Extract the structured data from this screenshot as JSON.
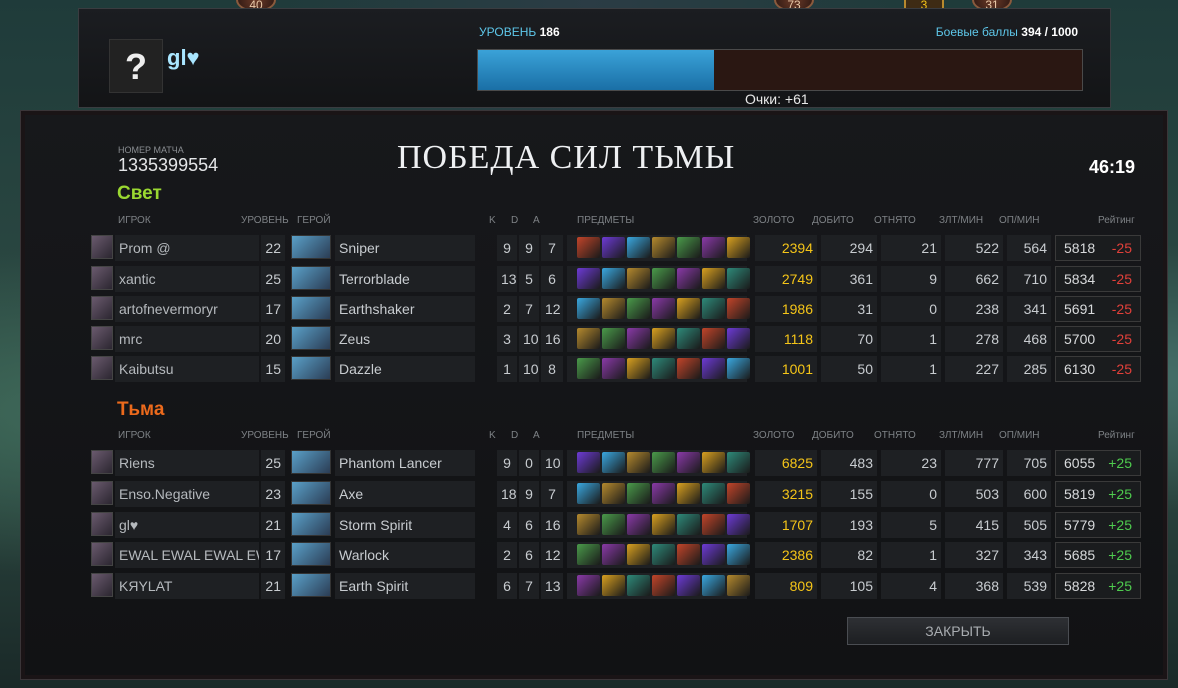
{
  "top_badges": [
    "40",
    "73",
    "3",
    "31"
  ],
  "profile": {
    "avatar": "?",
    "name": "gl♥"
  },
  "level": {
    "label": "УРОВЕНЬ",
    "value": "186",
    "progress": 0.39
  },
  "battle_points": {
    "label": "Боевые баллы",
    "value": "394 / 1000"
  },
  "score_gain": "Очки: +61",
  "match": {
    "label": "НОМЕР МАТЧА",
    "id": "1335399554",
    "result": "ПОБЕДА СИЛ ТЬМЫ",
    "duration": "46:19"
  },
  "headers": {
    "player": "ИГРОК",
    "level": "УРОВЕНЬ",
    "hero": "ГЕРОЙ",
    "k": "K",
    "d": "D",
    "a": "A",
    "items": "ПРЕДМЕТЫ",
    "gold": "ЗОЛОТО",
    "lh": "ДОБИТО",
    "dn": "ОТНЯТО",
    "gpm": "ЗЛТ/МИН",
    "xpm": "ОП/МИН",
    "rating": "Рейтинг"
  },
  "teams": [
    {
      "name": "Свет",
      "players": [
        {
          "player": "Prom @",
          "level": "22",
          "hero": "Sniper",
          "k": "9",
          "d": "9",
          "a": "7",
          "gold": "2394",
          "lh": "294",
          "dn": "21",
          "gpm": "522",
          "xpm": "564",
          "rating": "5818",
          "delta": "-25"
        },
        {
          "player": "xantic",
          "level": "25",
          "hero": "Terrorblade",
          "k": "13",
          "d": "5",
          "a": "6",
          "gold": "2749",
          "lh": "361",
          "dn": "9",
          "gpm": "662",
          "xpm": "710",
          "rating": "5834",
          "delta": "-25"
        },
        {
          "player": "artofnevermoryr",
          "level": "17",
          "hero": "Earthshaker",
          "k": "2",
          "d": "7",
          "a": "12",
          "gold": "1986",
          "lh": "31",
          "dn": "0",
          "gpm": "238",
          "xpm": "341",
          "rating": "5691",
          "delta": "-25"
        },
        {
          "player": "mrc",
          "level": "20",
          "hero": "Zeus",
          "k": "3",
          "d": "10",
          "a": "16",
          "gold": "1118",
          "lh": "70",
          "dn": "1",
          "gpm": "278",
          "xpm": "468",
          "rating": "5700",
          "delta": "-25"
        },
        {
          "player": "Kaibutsu",
          "level": "15",
          "hero": "Dazzle",
          "k": "1",
          "d": "10",
          "a": "8",
          "gold": "1001",
          "lh": "50",
          "dn": "1",
          "gpm": "227",
          "xpm": "285",
          "rating": "6130",
          "delta": "-25"
        }
      ]
    },
    {
      "name": "Тьма",
      "players": [
        {
          "player": "Riens",
          "level": "25",
          "hero": "Phantom Lancer",
          "k": "9",
          "d": "0",
          "a": "10",
          "gold": "6825",
          "lh": "483",
          "dn": "23",
          "gpm": "777",
          "xpm": "705",
          "rating": "6055",
          "delta": "+25"
        },
        {
          "player": "Enso.Negative",
          "level": "23",
          "hero": "Axe",
          "k": "18",
          "d": "9",
          "a": "7",
          "gold": "3215",
          "lh": "155",
          "dn": "0",
          "gpm": "503",
          "xpm": "600",
          "rating": "5819",
          "delta": "+25"
        },
        {
          "player": "gl♥",
          "level": "21",
          "hero": "Storm Spirit",
          "k": "4",
          "d": "6",
          "a": "16",
          "gold": "1707",
          "lh": "193",
          "dn": "5",
          "gpm": "415",
          "xpm": "505",
          "rating": "5779",
          "delta": "+25"
        },
        {
          "player": "EWAL EWAL EWAL EWAL",
          "level": "17",
          "hero": "Warlock",
          "k": "2",
          "d": "6",
          "a": "12",
          "gold": "2386",
          "lh": "82",
          "dn": "1",
          "gpm": "327",
          "xpm": "343",
          "rating": "5685",
          "delta": "+25"
        },
        {
          "player": "KЯYLAT",
          "level": "21",
          "hero": "Earth Spirit",
          "k": "6",
          "d": "7",
          "a": "13",
          "gold": "809",
          "lh": "105",
          "dn": "4",
          "gpm": "368",
          "xpm": "539",
          "rating": "5828",
          "delta": "+25"
        }
      ]
    }
  ],
  "close_button": "ЗАКРЫТЬ",
  "colors": {
    "radiant": "#9ad831",
    "dire": "#ec6a1c",
    "gold": "#f5c518",
    "negative": "#e0403a",
    "positive": "#4ecb4e",
    "xp": "#2a8fc4"
  }
}
